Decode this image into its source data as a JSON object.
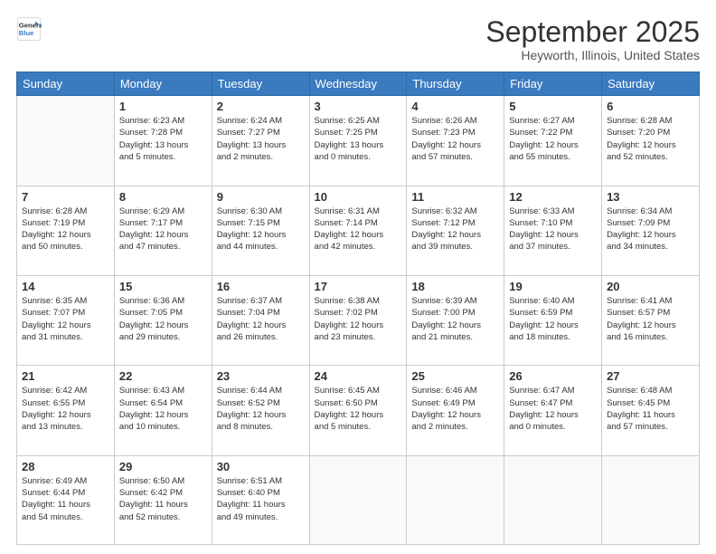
{
  "logo": {
    "line1": "General",
    "line2": "Blue"
  },
  "title": "September 2025",
  "subtitle": "Heyworth, Illinois, United States",
  "days_of_week": [
    "Sunday",
    "Monday",
    "Tuesday",
    "Wednesday",
    "Thursday",
    "Friday",
    "Saturday"
  ],
  "weeks": [
    [
      {
        "day": "",
        "info": ""
      },
      {
        "day": "1",
        "info": "Sunrise: 6:23 AM\nSunset: 7:28 PM\nDaylight: 13 hours\nand 5 minutes."
      },
      {
        "day": "2",
        "info": "Sunrise: 6:24 AM\nSunset: 7:27 PM\nDaylight: 13 hours\nand 2 minutes."
      },
      {
        "day": "3",
        "info": "Sunrise: 6:25 AM\nSunset: 7:25 PM\nDaylight: 13 hours\nand 0 minutes."
      },
      {
        "day": "4",
        "info": "Sunrise: 6:26 AM\nSunset: 7:23 PM\nDaylight: 12 hours\nand 57 minutes."
      },
      {
        "day": "5",
        "info": "Sunrise: 6:27 AM\nSunset: 7:22 PM\nDaylight: 12 hours\nand 55 minutes."
      },
      {
        "day": "6",
        "info": "Sunrise: 6:28 AM\nSunset: 7:20 PM\nDaylight: 12 hours\nand 52 minutes."
      }
    ],
    [
      {
        "day": "7",
        "info": "Sunrise: 6:28 AM\nSunset: 7:19 PM\nDaylight: 12 hours\nand 50 minutes."
      },
      {
        "day": "8",
        "info": "Sunrise: 6:29 AM\nSunset: 7:17 PM\nDaylight: 12 hours\nand 47 minutes."
      },
      {
        "day": "9",
        "info": "Sunrise: 6:30 AM\nSunset: 7:15 PM\nDaylight: 12 hours\nand 44 minutes."
      },
      {
        "day": "10",
        "info": "Sunrise: 6:31 AM\nSunset: 7:14 PM\nDaylight: 12 hours\nand 42 minutes."
      },
      {
        "day": "11",
        "info": "Sunrise: 6:32 AM\nSunset: 7:12 PM\nDaylight: 12 hours\nand 39 minutes."
      },
      {
        "day": "12",
        "info": "Sunrise: 6:33 AM\nSunset: 7:10 PM\nDaylight: 12 hours\nand 37 minutes."
      },
      {
        "day": "13",
        "info": "Sunrise: 6:34 AM\nSunset: 7:09 PM\nDaylight: 12 hours\nand 34 minutes."
      }
    ],
    [
      {
        "day": "14",
        "info": "Sunrise: 6:35 AM\nSunset: 7:07 PM\nDaylight: 12 hours\nand 31 minutes."
      },
      {
        "day": "15",
        "info": "Sunrise: 6:36 AM\nSunset: 7:05 PM\nDaylight: 12 hours\nand 29 minutes."
      },
      {
        "day": "16",
        "info": "Sunrise: 6:37 AM\nSunset: 7:04 PM\nDaylight: 12 hours\nand 26 minutes."
      },
      {
        "day": "17",
        "info": "Sunrise: 6:38 AM\nSunset: 7:02 PM\nDaylight: 12 hours\nand 23 minutes."
      },
      {
        "day": "18",
        "info": "Sunrise: 6:39 AM\nSunset: 7:00 PM\nDaylight: 12 hours\nand 21 minutes."
      },
      {
        "day": "19",
        "info": "Sunrise: 6:40 AM\nSunset: 6:59 PM\nDaylight: 12 hours\nand 18 minutes."
      },
      {
        "day": "20",
        "info": "Sunrise: 6:41 AM\nSunset: 6:57 PM\nDaylight: 12 hours\nand 16 minutes."
      }
    ],
    [
      {
        "day": "21",
        "info": "Sunrise: 6:42 AM\nSunset: 6:55 PM\nDaylight: 12 hours\nand 13 minutes."
      },
      {
        "day": "22",
        "info": "Sunrise: 6:43 AM\nSunset: 6:54 PM\nDaylight: 12 hours\nand 10 minutes."
      },
      {
        "day": "23",
        "info": "Sunrise: 6:44 AM\nSunset: 6:52 PM\nDaylight: 12 hours\nand 8 minutes."
      },
      {
        "day": "24",
        "info": "Sunrise: 6:45 AM\nSunset: 6:50 PM\nDaylight: 12 hours\nand 5 minutes."
      },
      {
        "day": "25",
        "info": "Sunrise: 6:46 AM\nSunset: 6:49 PM\nDaylight: 12 hours\nand 2 minutes."
      },
      {
        "day": "26",
        "info": "Sunrise: 6:47 AM\nSunset: 6:47 PM\nDaylight: 12 hours\nand 0 minutes."
      },
      {
        "day": "27",
        "info": "Sunrise: 6:48 AM\nSunset: 6:45 PM\nDaylight: 11 hours\nand 57 minutes."
      }
    ],
    [
      {
        "day": "28",
        "info": "Sunrise: 6:49 AM\nSunset: 6:44 PM\nDaylight: 11 hours\nand 54 minutes."
      },
      {
        "day": "29",
        "info": "Sunrise: 6:50 AM\nSunset: 6:42 PM\nDaylight: 11 hours\nand 52 minutes."
      },
      {
        "day": "30",
        "info": "Sunrise: 6:51 AM\nSunset: 6:40 PM\nDaylight: 11 hours\nand 49 minutes."
      },
      {
        "day": "",
        "info": ""
      },
      {
        "day": "",
        "info": ""
      },
      {
        "day": "",
        "info": ""
      },
      {
        "day": "",
        "info": ""
      }
    ]
  ]
}
